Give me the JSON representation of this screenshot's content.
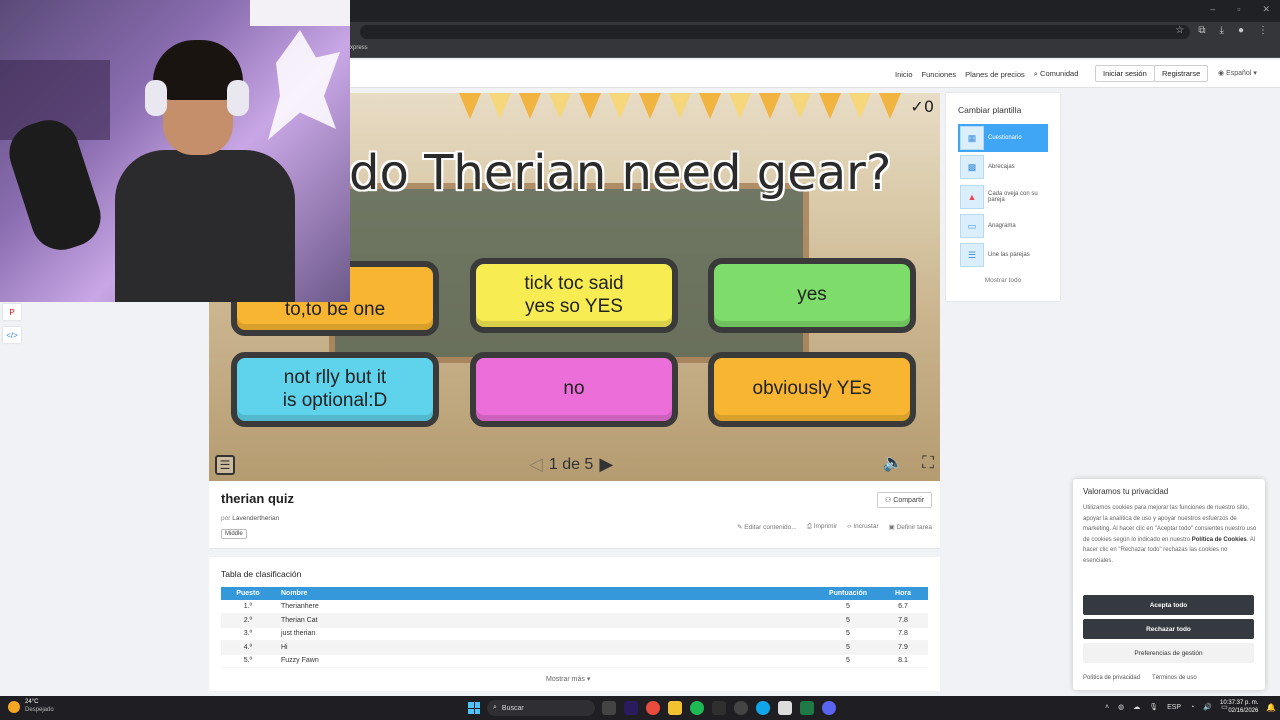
{
  "browser": {
    "bookmark_partial": "xpress",
    "window_controls": [
      "–",
      "▫",
      "✕"
    ]
  },
  "nav": {
    "links": [
      "Inicio",
      "Funciones",
      "Planes de precios",
      "Comunidad"
    ],
    "login": "Iniciar sesión",
    "register": "Registrarse",
    "language": "Español"
  },
  "quiz": {
    "score": "0",
    "question": "do Therian need gear?",
    "answers": [
      "ave\nto,to be one",
      "tick toc said\nyes so YES",
      "yes",
      "not rlly but it\nis optional:D",
      "no",
      "obviously YEs"
    ],
    "pager": "1 de 5"
  },
  "info": {
    "title": "therian quiz",
    "by_label": "por",
    "author": "Lavendertherian",
    "tag": "Middle",
    "share": "Compartir",
    "actions": [
      "Editar contenido...",
      "Imprimir",
      "Incrustar",
      "Definir tarea"
    ]
  },
  "leaderboard": {
    "title": "Tabla de clasificación",
    "headers": [
      "Puesto",
      "Nombre",
      "Puntuación",
      "Hora"
    ],
    "rows": [
      [
        "1.º",
        "Therianhere",
        "5",
        "6.7"
      ],
      [
        "2.º",
        "Therian Cat",
        "5",
        "7.8"
      ],
      [
        "3.º",
        "just therian",
        "5",
        "7.8"
      ],
      [
        "4.º",
        "Hi",
        "5",
        "7.9"
      ],
      [
        "5.º",
        "Fuzzy Fawn",
        "5",
        "8.1"
      ]
    ],
    "more": "Mostrar más"
  },
  "templates": {
    "title": "Cambiar plantilla",
    "items": [
      "Cuestionario",
      "Abrecajas",
      "Cada oveja con su pareja",
      "Anagrama",
      "Une las parejas"
    ],
    "more": "Mostrar todo"
  },
  "cookie": {
    "title": "Valoramos tu privacidad",
    "text_before": "Utilizamos cookies para mejorar las funciones de nuestro sitio, apoyar la analítica de uso y apoyar nuestros esfuerzos de marketing. Al hacer clic en \"Aceptar todo\" consientes nuestro uso de cookies según lo indicado en nuestro ",
    "policy_link": "Política de Cookies",
    "text_after": ". Al hacer clic en \"Rechazar todo\" rechazas las cookies no esenciales.",
    "accept": "Acepta todo",
    "reject": "Rechazar todo",
    "prefs": "Preferencias de gestión",
    "privacy": "Política de privacidad",
    "terms": "Términos de uso"
  },
  "taskbar": {
    "temp": "24°C",
    "weather": "Despejado",
    "search": "Buscar",
    "lang": "ESP",
    "time": "10:37:37 p. m.",
    "date": "02/16/2026"
  },
  "colors": {
    "leaderboard_header": "#3498db",
    "template_active": "#3fa6f5",
    "cookie_button": "#343a40"
  }
}
